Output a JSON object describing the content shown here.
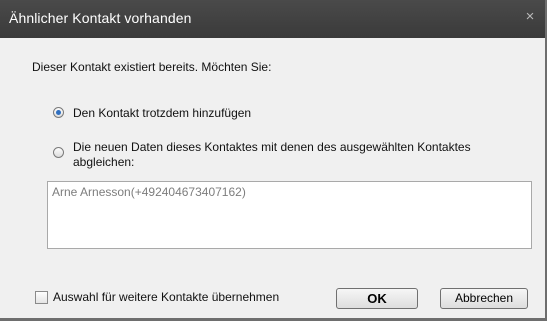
{
  "window": {
    "title": "Ähnlicher Kontakt vorhanden",
    "close_glyph": "×"
  },
  "prompt": "Dieser Kontakt existiert bereits. Möchten Sie:",
  "options": [
    {
      "label": "Den Kontakt trotzdem hinzufügen",
      "selected": true
    },
    {
      "label": "Die neuen Daten dieses Kontaktes mit denen des ausgewählten Kontaktes abgleichen:",
      "selected": false
    }
  ],
  "contacts": [
    "Arne Arnesson(+492404673407162)"
  ],
  "footer": {
    "apply_all_label": "Auswahl für weitere Kontakte übernehmen",
    "apply_all_checked": false,
    "ok_label": "OK",
    "cancel_label": "Abbrechen"
  },
  "colors": {
    "accent": "#2f6fc0",
    "titlebar": "#3a3a3a"
  }
}
